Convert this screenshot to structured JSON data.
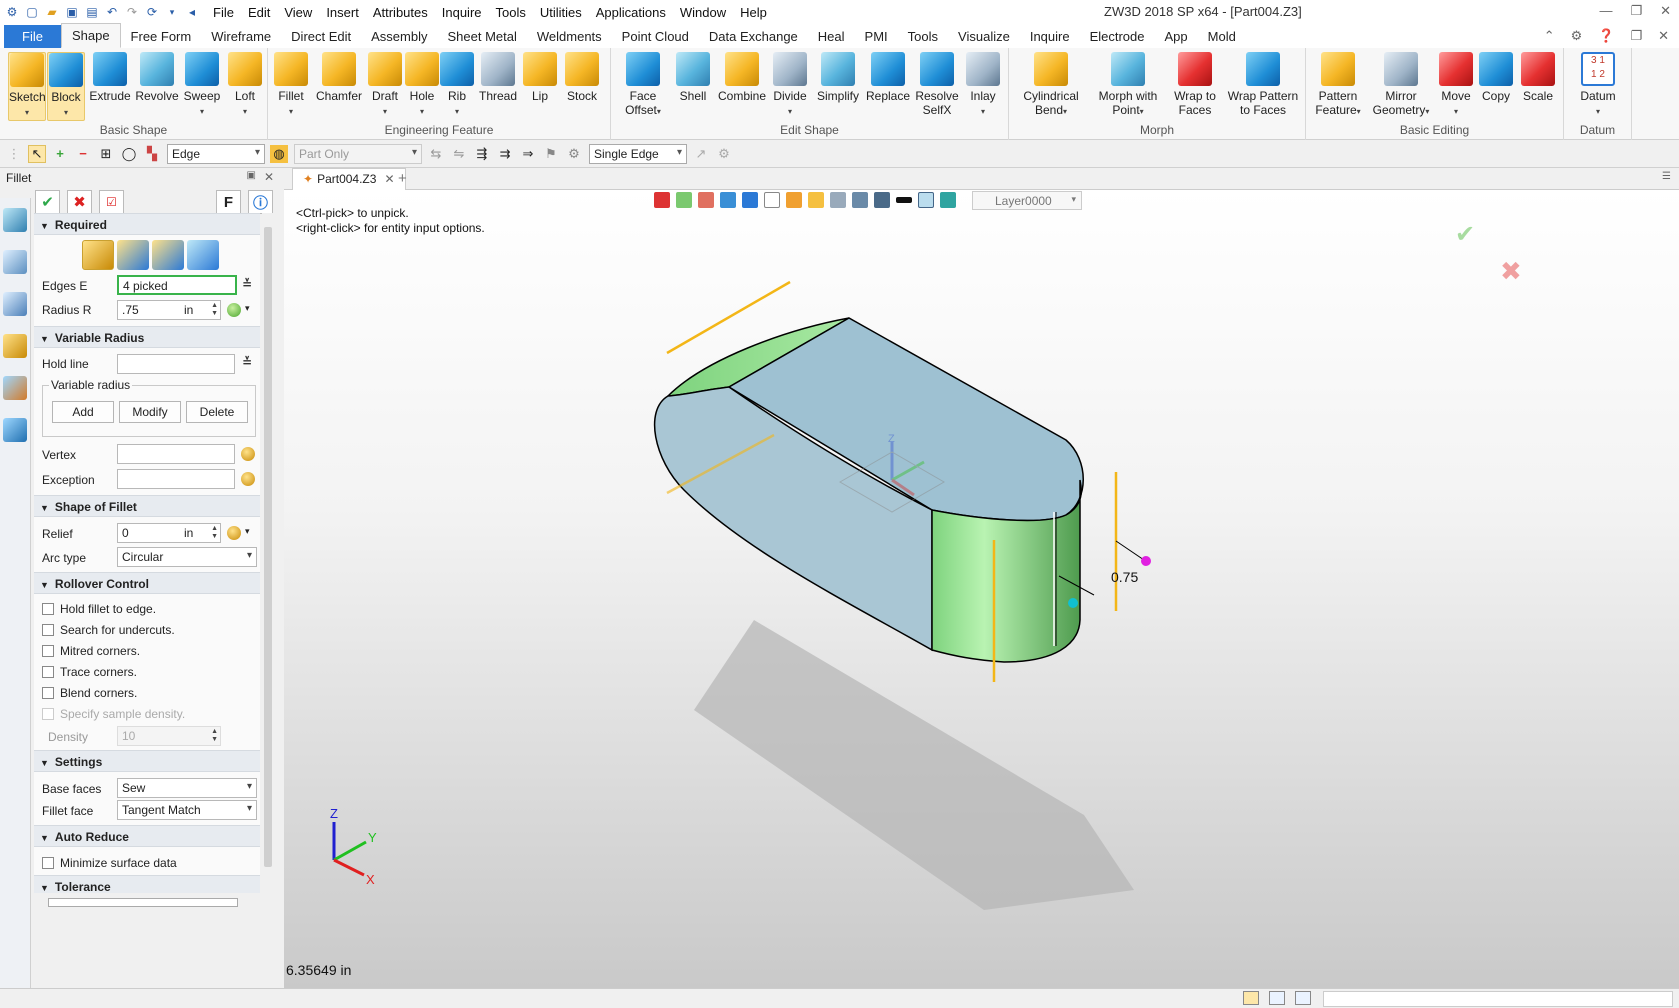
{
  "window": {
    "title": "ZW3D 2018 SP x64 - [Part004.Z3]",
    "menu": [
      "File",
      "Edit",
      "View",
      "Insert",
      "Attributes",
      "Inquire",
      "Tools",
      "Utilities",
      "Applications",
      "Window",
      "Help"
    ]
  },
  "ribbon_tabs": [
    "File",
    "Shape",
    "Free Form",
    "Wireframe",
    "Direct Edit",
    "Assembly",
    "Sheet Metal",
    "Weldments",
    "Point Cloud",
    "Data Exchange",
    "Heal",
    "PMI",
    "Tools",
    "Visualize",
    "Inquire",
    "Electrode",
    "App",
    "Mold"
  ],
  "active_tab": "Shape",
  "ribbon": {
    "basic_shape": {
      "label": "Basic Shape",
      "buttons": [
        "Sketch",
        "Block",
        "Extrude",
        "Revolve",
        "Sweep",
        "Loft"
      ]
    },
    "engineering_feature": {
      "label": "Engineering Feature",
      "buttons": [
        "Fillet",
        "Chamfer",
        "Draft",
        "Hole",
        "Rib",
        "Thread",
        "Lip",
        "Stock"
      ]
    },
    "edit_shape": {
      "label": "Edit Shape",
      "buttons": [
        "Face Offset",
        "Shell",
        "Combine",
        "Divide",
        "Simplify",
        "Replace",
        "Resolve SelfX",
        "Inlay"
      ]
    },
    "morph": {
      "label": "Morph",
      "buttons": [
        "Cylindrical Bend",
        "Morph with Point",
        "Wrap to Faces",
        "Wrap Pattern to Faces"
      ]
    },
    "basic_editing": {
      "label": "Basic Editing",
      "buttons": [
        "Pattern Feature",
        "Mirror Geometry",
        "Move",
        "Copy",
        "Scale"
      ]
    },
    "datum": {
      "label": "Datum",
      "buttons": [
        "Datum"
      ]
    }
  },
  "toolbar2": {
    "filter": "Edge",
    "scope": "Part Only",
    "pick_mode": "Single Edge"
  },
  "panel": {
    "title": "Fillet",
    "f_button": "F",
    "required": {
      "label": "Required",
      "edges_label": "Edges E",
      "edges_value": "4 picked",
      "radius_label": "Radius R",
      "radius_value": ".75",
      "radius_unit": "in"
    },
    "variable_radius": {
      "label": "Variable Radius",
      "hold_line_label": "Hold line",
      "group_label": "Variable radius",
      "add": "Add",
      "modify": "Modify",
      "delete": "Delete",
      "vertex_label": "Vertex",
      "exception_label": "Exception"
    },
    "shape_of_fillet": {
      "label": "Shape of Fillet",
      "relief_label": "Relief",
      "relief_value": "0",
      "relief_unit": "in",
      "arc_type_label": "Arc type",
      "arc_type_value": "Circular"
    },
    "rollover_control": {
      "label": "Rollover Control",
      "options": [
        "Hold fillet to edge.",
        "Search for undercuts.",
        "Mitred corners.",
        "Trace corners.",
        "Blend corners.",
        "Specify sample density."
      ],
      "density_label": "Density",
      "density_value": "10"
    },
    "settings": {
      "label": "Settings",
      "base_faces_label": "Base faces",
      "base_faces_value": "Sew",
      "fillet_face_label": "Fillet face",
      "fillet_face_value": "Tangent Match"
    },
    "auto_reduce": {
      "label": "Auto Reduce",
      "option": "Minimize surface data"
    },
    "tolerance": {
      "label": "Tolerance"
    }
  },
  "document_tab": "Part004.Z3",
  "viewport": {
    "hint1": "<Ctrl-pick> to unpick.",
    "hint2": "<right-click> for entity input options.",
    "layer": "Layer0000",
    "dimension": "0.75",
    "measure": "6.35649 in",
    "triad_z": "Z",
    "triad_y": "Y",
    "triad_x": "X",
    "axis_z": "Z"
  }
}
